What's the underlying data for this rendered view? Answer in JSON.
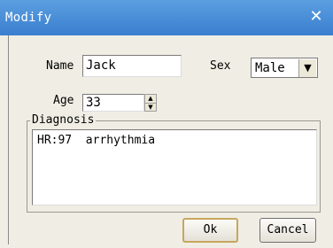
{
  "window": {
    "title": "Modify",
    "close_icon": "✕"
  },
  "form": {
    "name_label": "Name",
    "name_value": "Jack",
    "sex_label": "Sex",
    "sex_value": "Male",
    "dropdown_icon": "▼",
    "age_label": "Age",
    "age_value": "33",
    "spin_up_icon": "▲",
    "spin_down_icon": "▼"
  },
  "diagnosis": {
    "group_label": "Diagnosis",
    "text": "HR:97  arrhythmia"
  },
  "buttons": {
    "ok_label": "Ok",
    "cancel_label": "Cancel"
  }
}
